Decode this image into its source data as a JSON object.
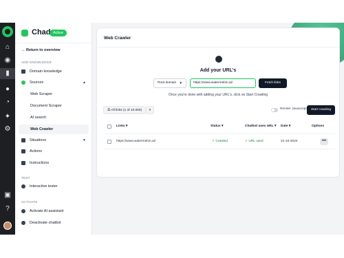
{
  "app": {
    "bot_name": "Chad",
    "status_badge": "Active"
  },
  "sidebar": {
    "back_label": "Return to overview",
    "section_ai_knowledge": "Add knowledge",
    "domain_knowledge": "Domain knowledge",
    "sources": "Sources",
    "web_scraper": "Web Scraper",
    "document_scraper": "Document Scraper",
    "ai_search": "AI search",
    "web_crawler": "Web Crawler",
    "situations": "Situations",
    "actions": "Actions",
    "instructions": "Instructions",
    "section_test": "Test",
    "interactive_tester": "Interactive tester",
    "section_activate": "Activate",
    "activate_ai": "Activate AI assistant",
    "deactivate_chatbot": "Deactivate chatbot"
  },
  "page": {
    "title": "Web Crawler"
  },
  "add_urls": {
    "heading": "Add your URL's",
    "select_value": "Root domain",
    "url_value": "https://www.watermelon.ai/",
    "fetch_label": "Fetch links",
    "hint": "Once you're done with adding your URL's, click on Start Crawling"
  },
  "toolbar": {
    "filter_label": "All links (1 of 10.000)",
    "render_label": "Render Javascript",
    "crawl_label": "Start crawling"
  },
  "table": {
    "columns": [
      "Links",
      "Status",
      "Chatbot uses URL",
      "Date",
      "Options"
    ],
    "rows": [
      {
        "link": "https://www.watermelon.ai/",
        "status": "Crawled",
        "uses": "URL used",
        "date": "21-10-2024",
        "options": "•••"
      }
    ]
  },
  "colors": {
    "accent": "#22c55e",
    "dark": "#111827",
    "rail": "#1d1f23"
  }
}
